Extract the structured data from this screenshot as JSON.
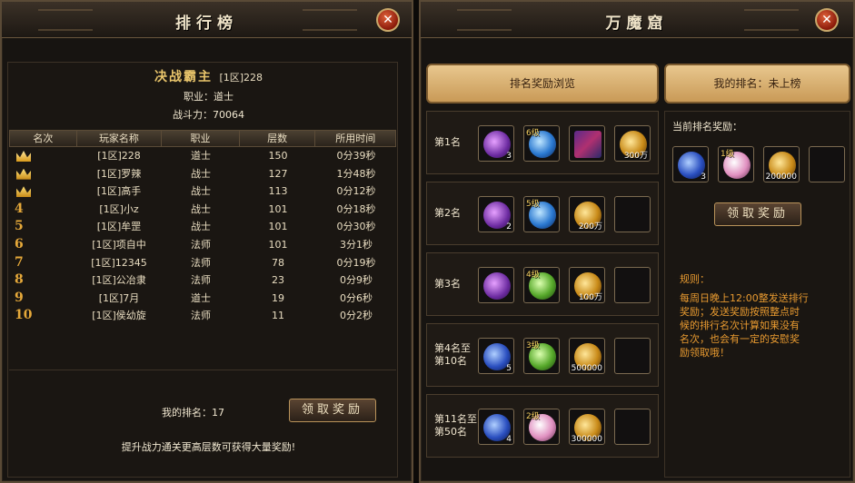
{
  "left_panel": {
    "title": "排行榜",
    "player": {
      "name": "决战霸主",
      "server": "[1区]228",
      "class_line": "职业：道士",
      "power_line": "战斗力：70064"
    },
    "columns": [
      "名次",
      "玩家名称",
      "职业",
      "层数",
      "所用时间"
    ],
    "rows": [
      {
        "rank": "",
        "crown": "gold-1",
        "name": "[1区]228",
        "class": "道士",
        "floor": "150",
        "time": "0分39秒"
      },
      {
        "rank": "",
        "crown": "gold-2",
        "name": "[1区]罗辣",
        "class": "战士",
        "floor": "127",
        "time": "1分48秒"
      },
      {
        "rank": "",
        "crown": "gold-3",
        "name": "[1区]高手",
        "class": "战士",
        "floor": "113",
        "time": "0分12秒"
      },
      {
        "rank": "4",
        "name": "[1区]小z",
        "class": "战士",
        "floor": "101",
        "time": "0分18秒"
      },
      {
        "rank": "5",
        "name": "[1区]牟罡",
        "class": "战士",
        "floor": "101",
        "time": "0分30秒"
      },
      {
        "rank": "6",
        "name": "[1区]项自中",
        "class": "法师",
        "floor": "101",
        "time": "3分1秒"
      },
      {
        "rank": "7",
        "name": "[1区]12345",
        "class": "法师",
        "floor": "78",
        "time": "0分19秒"
      },
      {
        "rank": "8",
        "name": "[1区]公冶隶",
        "class": "法师",
        "floor": "23",
        "time": "0分9秒"
      },
      {
        "rank": "9",
        "name": "[1区]7月",
        "class": "道士",
        "floor": "19",
        "time": "0分6秒"
      },
      {
        "rank": "10",
        "name": "[1区]侯幼旋",
        "class": "法师",
        "floor": "11",
        "time": "0分2秒"
      }
    ],
    "my_rank": "我的排名：17",
    "claim_label": "领取奖励",
    "tip": "提升战力通关更高层数可获得大量奖励!"
  },
  "right_panel": {
    "title": "万魔窟",
    "tab_preview": "排名奖励浏览",
    "tab_myrank": "我的排名：未上榜",
    "reward_blocks": [
      {
        "label": "第1名",
        "items": [
          {
            "icon": "purple-amulet-icon",
            "color": "purple",
            "qty": "3",
            "lvl": ""
          },
          {
            "icon": "blue-orb-bag-icon",
            "color": "blueglobe",
            "qty": "",
            "lvl": "6级"
          },
          {
            "icon": "dragon-mount-icon",
            "color": "dragon",
            "qty": "",
            "lvl": ""
          },
          {
            "icon": "gold-ingot-icon",
            "color": "gold",
            "qty": "300万",
            "lvl": ""
          }
        ]
      },
      {
        "label": "第2名",
        "items": [
          {
            "icon": "purple-amulet-icon",
            "color": "purple",
            "qty": "2",
            "lvl": ""
          },
          {
            "icon": "blue-orb-bag-icon",
            "color": "blueglobe",
            "qty": "",
            "lvl": "5级"
          },
          {
            "icon": "gold-ingot-icon",
            "color": "gold",
            "qty": "200万",
            "lvl": ""
          },
          {
            "icon": "empty-slot-icon",
            "color": "",
            "qty": "",
            "lvl": ""
          }
        ]
      },
      {
        "label": "第3名",
        "items": [
          {
            "icon": "purple-amulet-icon",
            "color": "purple",
            "qty": "",
            "lvl": ""
          },
          {
            "icon": "green-orb-bag-icon",
            "color": "green",
            "qty": "",
            "lvl": "4级"
          },
          {
            "icon": "gold-ingot-icon",
            "color": "gold",
            "qty": "100万",
            "lvl": ""
          },
          {
            "icon": "empty-slot-icon",
            "color": "",
            "qty": "",
            "lvl": ""
          }
        ]
      },
      {
        "label": "第4名至第10名",
        "items": [
          {
            "icon": "blue-amulet-icon",
            "color": "blue",
            "qty": "5",
            "lvl": ""
          },
          {
            "icon": "green-orb-bag-icon",
            "color": "green",
            "qty": "",
            "lvl": "3级"
          },
          {
            "icon": "gold-ingot-icon",
            "color": "gold",
            "qty": "500000",
            "lvl": ""
          },
          {
            "icon": "empty-slot-icon",
            "color": "",
            "qty": "",
            "lvl": ""
          }
        ]
      },
      {
        "label": "第11名至第50名",
        "items": [
          {
            "icon": "blue-amulet-icon",
            "color": "blue",
            "qty": "4",
            "lvl": ""
          },
          {
            "icon": "pink-orb-bag-icon",
            "color": "pink",
            "qty": "",
            "lvl": "2级"
          },
          {
            "icon": "gold-ingot-icon",
            "color": "gold",
            "qty": "300000",
            "lvl": ""
          },
          {
            "icon": "empty-slot-icon",
            "color": "",
            "qty": "",
            "lvl": ""
          }
        ]
      }
    ],
    "current_title": "当前排名奖励：",
    "current_items": [
      {
        "icon": "blue-amulet-icon",
        "color": "blue",
        "qty": "3",
        "lvl": ""
      },
      {
        "icon": "pink-orb-bag-icon",
        "color": "pink",
        "qty": "",
        "lvl": "1级"
      },
      {
        "icon": "gold-ingot-icon",
        "color": "gold",
        "qty": "200000",
        "lvl": ""
      },
      {
        "icon": "empty-slot-icon",
        "color": "",
        "qty": "",
        "lvl": ""
      }
    ],
    "claim_label": "领取奖励",
    "rules_title": "规则：",
    "rules_text": "每周日晚上12:00整发送排行奖励；发送奖励按照整点时候的排行名次计算如果没有名次，也会有一定的安慰奖励领取哦！"
  },
  "close_symbol": "✕"
}
